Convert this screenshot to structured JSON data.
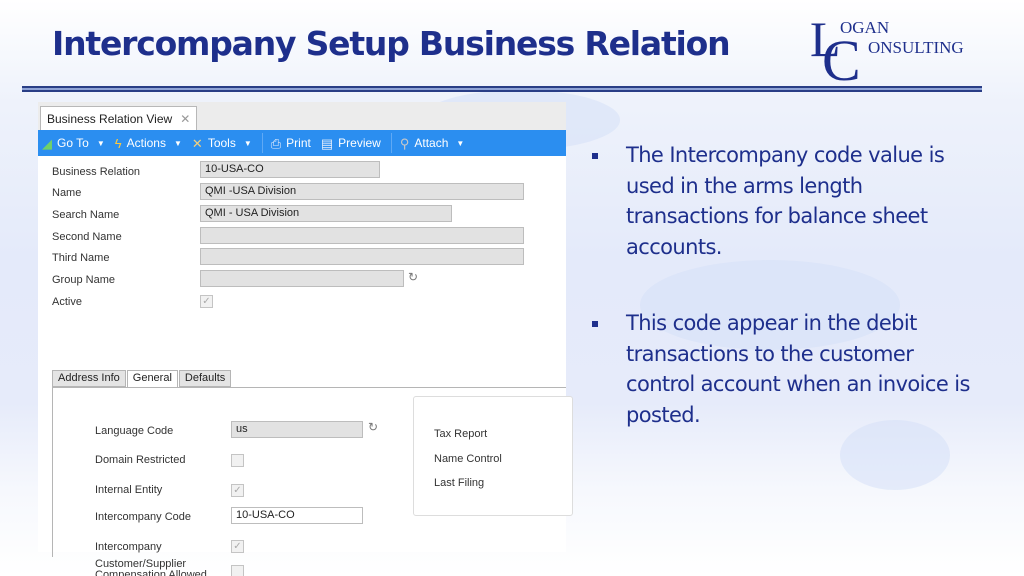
{
  "slide": {
    "title": "Intercompany Setup Business Relation",
    "logo": {
      "big_l": "L",
      "big_c": "C",
      "line1": "OGAN",
      "line2": "ONSULTING"
    }
  },
  "window": {
    "tab_label": "Business Relation View",
    "tab_close": "✕",
    "toolbar": [
      {
        "label": "Go To",
        "icon": "go-to-icon",
        "dropdown": true
      },
      {
        "label": "Actions",
        "icon": "lightning-icon",
        "dropdown": true
      },
      {
        "label": "Tools",
        "icon": "tools-icon",
        "dropdown": true
      },
      {
        "label": "Print",
        "icon": "printer-icon",
        "dropdown": false
      },
      {
        "label": "Preview",
        "icon": "preview-icon",
        "dropdown": false
      },
      {
        "label": "Attach",
        "icon": "paperclip-icon",
        "dropdown": true
      }
    ],
    "fields": [
      {
        "label": "Business Relation",
        "value": "10-USA-CO"
      },
      {
        "label": "Name",
        "value": "QMI -USA Division"
      },
      {
        "label": "Search Name",
        "value": "QMI - USA Division"
      },
      {
        "label": "Second Name",
        "value": ""
      },
      {
        "label": "Third Name",
        "value": ""
      },
      {
        "label": "Group Name",
        "value": ""
      },
      {
        "label": "Active",
        "checked": true
      }
    ],
    "subtabs": [
      "Address Info",
      "General",
      "Defaults"
    ],
    "active_subtab": "General",
    "general": {
      "language_code": {
        "label": "Language Code",
        "value": "us"
      },
      "domain_restricted": {
        "label": "Domain Restricted",
        "checked": false
      },
      "internal_entity": {
        "label": "Internal Entity",
        "checked": true
      },
      "intercompany_code": {
        "label": "Intercompany Code",
        "value": "10-USA-CO"
      },
      "intercompany": {
        "label": "Intercompany",
        "checked": true
      },
      "compensation": {
        "label_line1": "Customer/Supplier",
        "label_line2": "Compensation Allowed",
        "checked": false
      }
    },
    "tax": {
      "tax_report": "Tax Report",
      "name_control": "Name Control",
      "last_filing": "Last Filing"
    }
  },
  "bullets": [
    "The Intercompany code value is used in the arms length transactions for balance sheet accounts.",
    "This code appear in the debit transactions to the customer control account when an invoice is posted."
  ],
  "glyphs": {
    "check": "✓",
    "caret": "▼",
    "lookup": "↻"
  }
}
